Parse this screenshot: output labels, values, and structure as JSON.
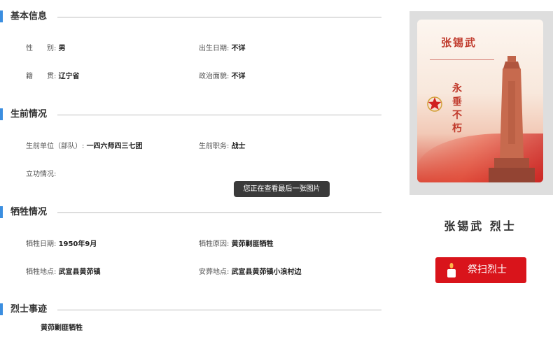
{
  "sections": {
    "basic": {
      "title": "基本信息"
    },
    "life": {
      "title": "生前情况"
    },
    "sacrifice": {
      "title": "牺牲情况"
    },
    "deeds": {
      "title": "烈士事迹"
    }
  },
  "basic": {
    "gender_label": "性　　别:",
    "gender_value": "男",
    "birth_label": "出生日期:",
    "birth_value": "不详",
    "origin_label": "籍　　贯:",
    "origin_value": "辽宁省",
    "political_label": "政治面貌:",
    "political_value": "不详"
  },
  "life": {
    "unit_label": "生前单位（部队）:",
    "unit_value": "一四六师四三七团",
    "duty_label": "生前职务:",
    "duty_value": "战士",
    "merit_label": "立功情况:",
    "merit_value": ""
  },
  "sacrifice": {
    "date_label": "牺牲日期:",
    "date_value": "1950年9月",
    "reason_label": "牺牲原因:",
    "reason_value": "黄茆剿匪牺牲",
    "place_label": "牺牲地点:",
    "place_value": "武宣县黄茆镇",
    "burial_label": "安葬地点:",
    "burial_value": "武宣县黄茆镇小浪村边"
  },
  "deeds": {
    "text": "黄茆剿匪牺牲"
  },
  "tooltip": {
    "text": "您正在查看最后一张图片"
  },
  "poster": {
    "name": "张锡武",
    "slogan": "永垂不朽"
  },
  "hero": {
    "name": "张锡武 烈士"
  },
  "tribute_button": {
    "label": "祭扫烈士"
  },
  "colors": {
    "accent": "#3b8ee0",
    "button": "#d9141b",
    "poster_red": "#c0392b"
  },
  "icons": [
    "star-icon",
    "candle-icon"
  ]
}
